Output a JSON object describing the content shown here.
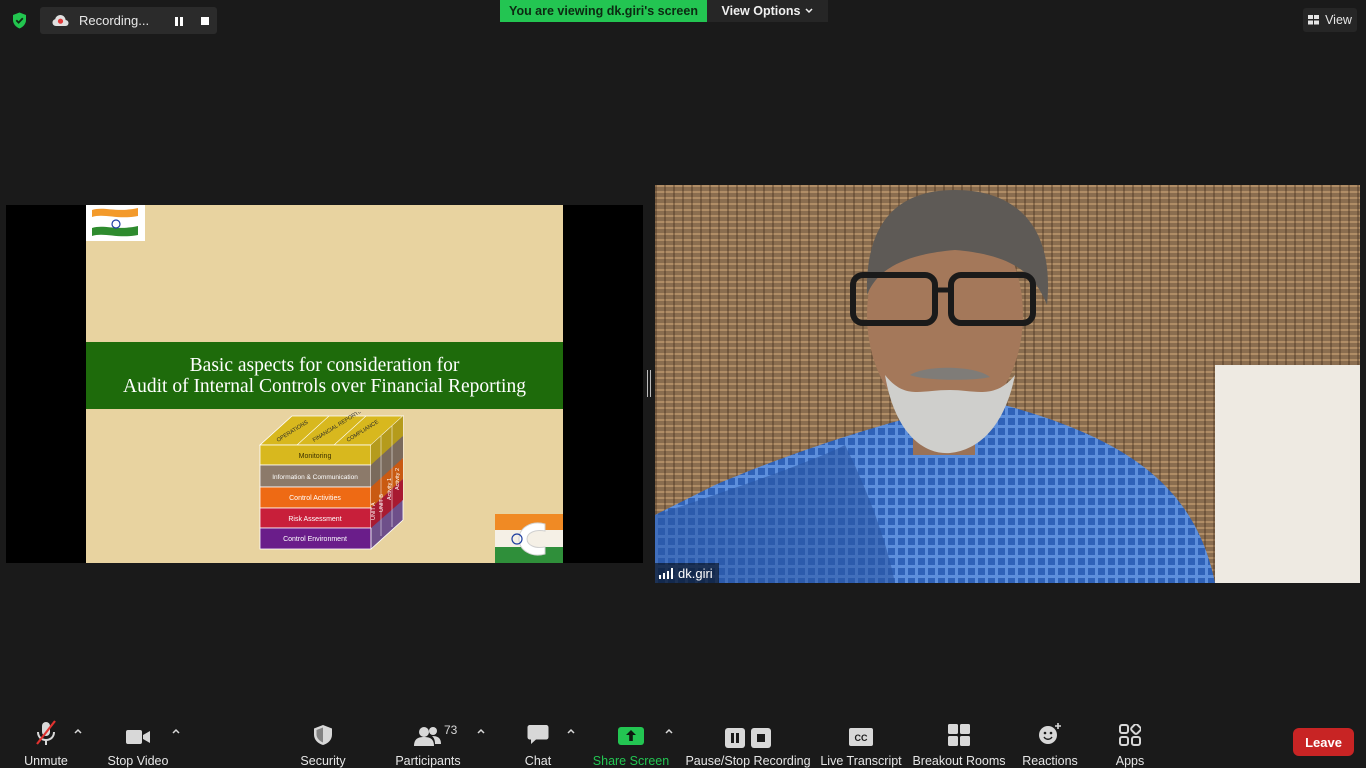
{
  "top_bar": {
    "recording_label": "Recording...",
    "viewing_banner": "You are viewing dk.giri's screen",
    "view_options_label": "View Options",
    "view_label": "View"
  },
  "slide": {
    "title_line1": "Basic aspects for consideration for",
    "title_line2": "Audit of Internal Controls over Financial Reporting",
    "cube": {
      "top_labels": [
        "OPERATIONS",
        "FINANCIAL REPORTING",
        "COMPLIANCE"
      ],
      "layers": [
        "Monitoring",
        "Information & Communication",
        "Control Activities",
        "Risk Assessment",
        "Control Environment"
      ],
      "side_labels": [
        "UNIT A",
        "UNIT B",
        "Activity 1",
        "Activity 2"
      ]
    }
  },
  "participant": {
    "name": "dk.giri"
  },
  "toolbar": {
    "unmute": "Unmute",
    "stop_video": "Stop Video",
    "security": "Security",
    "participants": "Participants",
    "participants_count": "73",
    "chat": "Chat",
    "share_screen": "Share Screen",
    "pause_stop_recording": "Pause/Stop Recording",
    "live_transcript": "Live Transcript",
    "breakout_rooms": "Breakout Rooms",
    "reactions": "Reactions",
    "apps": "Apps",
    "leave": "Leave"
  },
  "colors": {
    "accent_green": "#23c552",
    "leave_red": "#c82424",
    "slide_bg": "#e8d3a0",
    "slide_title_band": "#1e6b0b"
  }
}
